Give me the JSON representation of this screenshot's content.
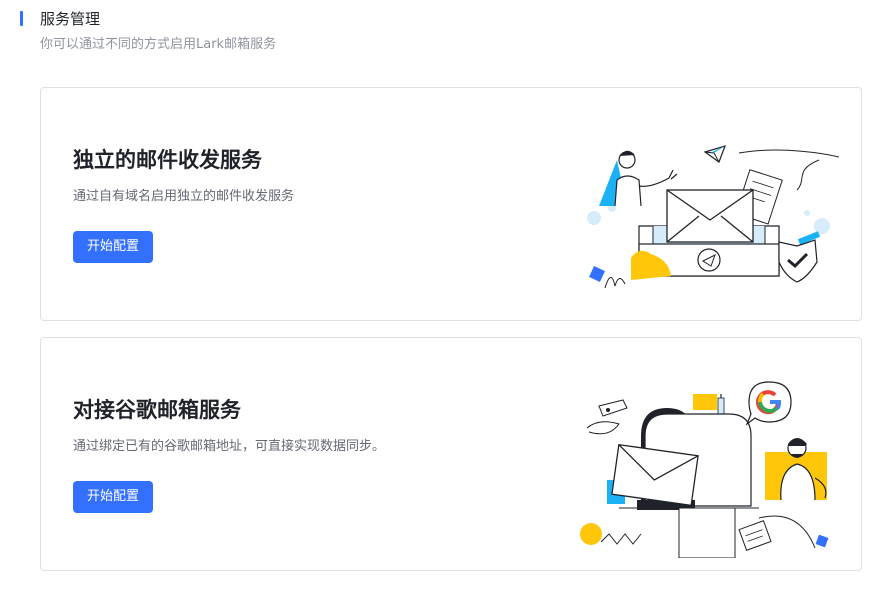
{
  "page": {
    "title": "服务管理",
    "subtitle": "你可以通过不同的方式启用Lark邮箱服务"
  },
  "cards": [
    {
      "title": "独立的邮件收发服务",
      "description": "通过自有域名启用独立的邮件收发服务",
      "button_label": "开始配置"
    },
    {
      "title": "对接谷歌邮箱服务",
      "description": "通过绑定已有的谷歌邮箱地址，可直接实现数据同步。",
      "button_label": "开始配置"
    }
  ],
  "colors": {
    "accent": "#3370ff",
    "yellow": "#ffc60a",
    "sky": "#1ab2f5",
    "light_blue": "#d6ecfb"
  },
  "icons": [
    "mail-envelope-icon",
    "checkmark-shield-icon",
    "google-logo-icon",
    "paper-plane-icon"
  ]
}
